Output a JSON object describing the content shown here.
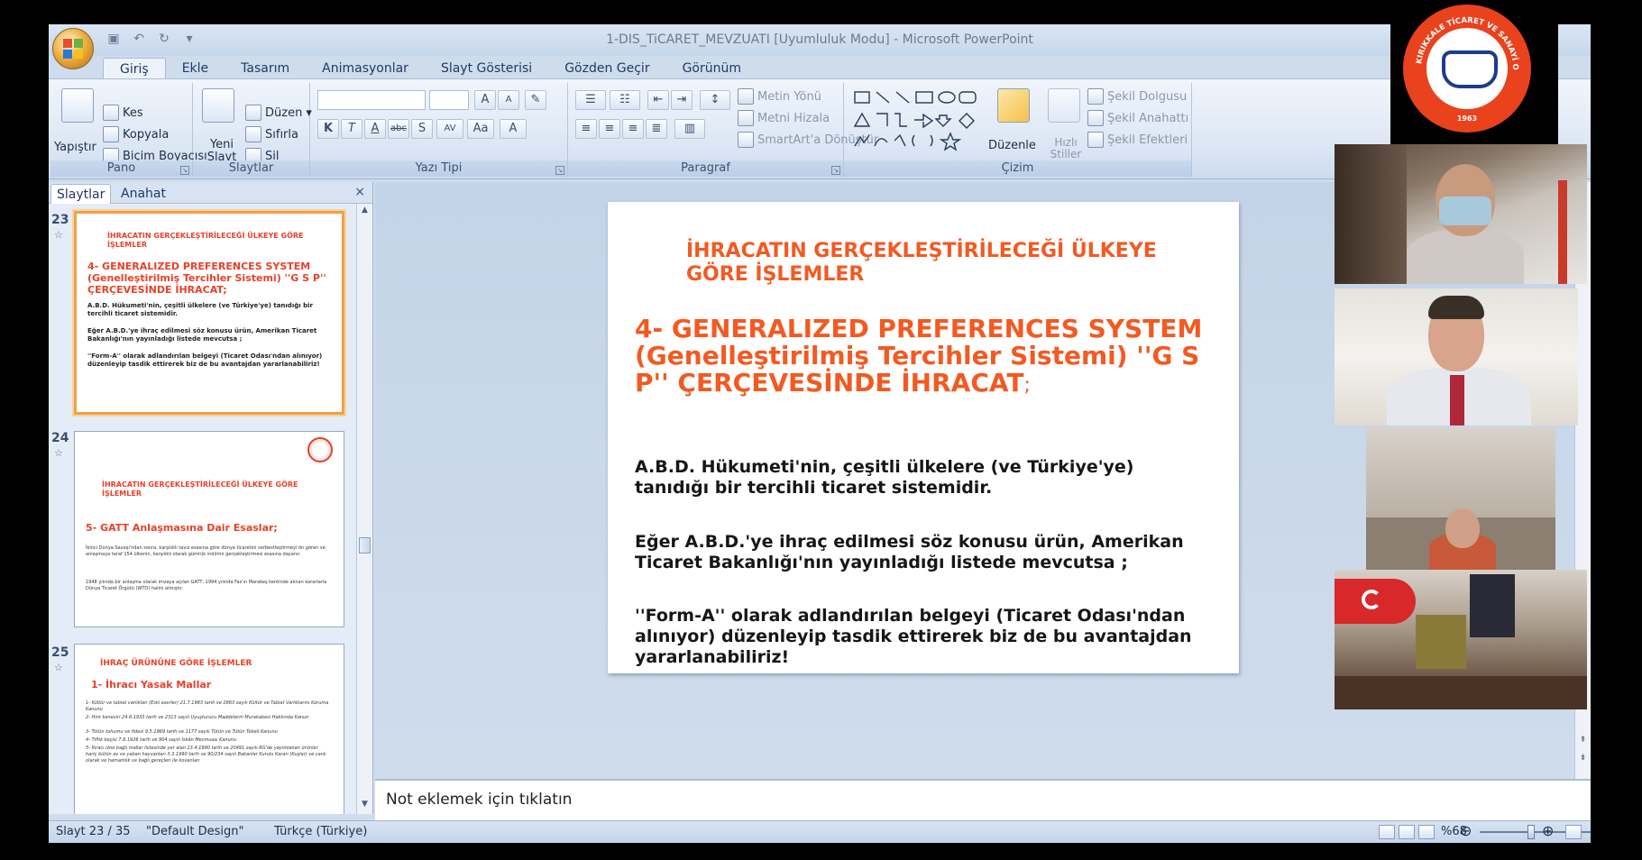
{
  "window": {
    "title": "1-DIS_TiCARET_MEVZUATI [Uyumluluk Modu] - Microsoft PowerPoint"
  },
  "tabs": [
    "Giriş",
    "Ekle",
    "Tasarım",
    "Animasyonlar",
    "Slayt Gösterisi",
    "Gözden Geçir",
    "Görünüm"
  ],
  "ribbon": {
    "pano": {
      "label": "Pano",
      "paste": "Yapıştır",
      "cut": "Kes",
      "copy": "Kopyala",
      "format_painter": "Biçim Boyacısı"
    },
    "slaytlar": {
      "label": "Slaytlar",
      "new_slide": "Yeni Slayt",
      "layout": "Düzen",
      "reset": "Sıfırla",
      "delete": "Sil"
    },
    "yazi_tipi": {
      "label": "Yazı Tipi",
      "bold": "K",
      "italic": "T",
      "underline": "A",
      "strike": "abc",
      "shadow": "S",
      "spacing": "AV",
      "case": "Aa",
      "color": "A",
      "grow": "A",
      "shrink": "A"
    },
    "paragraf": {
      "label": "Paragraf",
      "text_direction": "Metin Yönü",
      "align_text": "Metni Hizala",
      "smartart": "SmartArt'a Dönüştür"
    },
    "cizim": {
      "label": "Çizim",
      "arrange": "Düzenle",
      "quick_styles": "Hızlı Stiller",
      "shape_fill": "Şekil Dolgusu",
      "shape_outline": "Şekil Anahattı",
      "shape_effects": "Şekil Efektleri"
    }
  },
  "pane": {
    "tabs": [
      "Slaytlar",
      "Anahat"
    ],
    "close": "×",
    "thumbs": [
      {
        "num": "23",
        "heading": "İHRACATIN GERÇEKLEŞTİRİLECEĞİ ÜLKEYE GÖRE İŞLEMLER",
        "title": "4- GENERALIZED PREFERENCES SYSTEM (Genelleştirilmiş Tercihler Sistemi) ''G S P'' ÇERÇEVESİNDE İHRACAT;",
        "p1": "A.B.D. Hükumeti'nin, çeşitli ülkelere (ve Türkiye'ye) tanıdığı bir tercihli ticaret sistemidir.",
        "p2": "Eğer A.B.D.'ye ihraç edilmesi söz konusu ürün, Amerikan Ticaret Bakanlığı'nın yayınladığı listede mevcutsa ;",
        "p3": "''Form-A'' olarak adlandırılan belgeyi (Ticaret Odası'ndan alınıyor) düzenleyip tasdik ettirerek biz de bu avantajdan yararlanabiliriz!"
      },
      {
        "num": "24",
        "heading": "İHRACATIN GERÇEKLEŞTİRİLECEĞİ ÜLKEYE GÖRE İŞLEMLER",
        "title": "5- GATT Anlaşmasına Dair Esaslar;",
        "p1": "İkinci Dünya Savaşı'ndan sonra, karşılıklı tavız esasına göre dünya ticaretini serbestleştirmeyi ön gören ve anlaşmaya taraf 154 ülkenin, karşılıklı olarak gümrük indirimi gerçekleştirmesi esasına dayanır.",
        "p2": "1948 yılında bir anlaşma olarak imzaya açılan GATT, 1994 yılında Fas'ın Marakeş kentinde alınan kararlarla Dünya Ticaret Örgütü (WTO) halini almıştır."
      },
      {
        "num": "25",
        "title": "İHRAÇ ÜRÜNÜNE GÖRE İŞLEMLER",
        "subtitle": "1- İhracı Yasak Mallar",
        "p1": "1- Kültür ve tabiat varlıkları (Eski eserler) 21.7.1983 tarih ve 2863 sayılı Kültür ve Tabiat Varlıklarını Koruma Kanunu",
        "p2": "2- Hint keneviri 24.6.1933 tarih ve 2313 sayılı Uyuşturucu Maddelerin Murakabesi Hakkında Kanun",
        "p3": "3- Tütün tohumu ve fidesi 9.5.1969 tarih ve 1177 sayılı Tütün ve Tütün Tekeli Kanunu",
        "p4": "4- Tiftik keçisi 7.6.1926 tarih ve 904 sayılı İskân Mecmuası Kanunu",
        "p5": "5- İhracı izne bağlı mallar listesinde yer alan 13.4.1990 tarih ve 20491 sayılı RG'de yayımlanan ürünler hariç bütün av ve yaban hayvanları 3.3.1990 tarih ve 90/234 sayılı Bakanlar Kurulu Kararı (Kuşlar) ve canlı olarak ve hamamlık ve bağlı gereçleri ile kovanları"
      }
    ]
  },
  "slide": {
    "heading": "İHRACATIN GERÇEKLEŞTİRİLECEĞİ ÜLKEYE GÖRE İŞLEMLER",
    "title": "4- GENERALIZED PREFERENCES SYSTEM (Genelleştirilmiş Tercihler Sistemi) ''G S P'' ÇERÇEVESİNDE İHRACAT",
    "title_suffix": ";",
    "p1": "A.B.D. Hükumeti'nin, çeşitli ülkelere (ve Türkiye'ye) tanıdığı bir tercihli ticaret sistemidir.",
    "p2": "Eğer A.B.D.'ye ihraç edilmesi söz konusu ürün, Amerikan Ticaret Bakanlığı'nın yayınladığı listede mevcutsa ;",
    "p3": "''Form-A'' olarak adlandırılan belgeyi (Ticaret Odası'ndan alınıyor) düzenleyip tasdik ettirerek biz de bu avantajdan yararlanabiliriz!"
  },
  "notes": {
    "placeholder": "Not eklemek için tıklatın"
  },
  "status": {
    "slide": "Slayt 23 / 35",
    "design": "\"Default Design\"",
    "language": "Türkçe (Türkiye)",
    "zoom": "%68"
  },
  "meeting": {
    "logo_text": "KIRIKKALE TİCARET VE SANAYİ ODASI",
    "logo_year": "1963"
  },
  "colors": {
    "slide_accent": "#f25a22",
    "logo_red": "#e9421d",
    "logo_blue": "#1c3b8c",
    "selection": "#f1a04a"
  }
}
